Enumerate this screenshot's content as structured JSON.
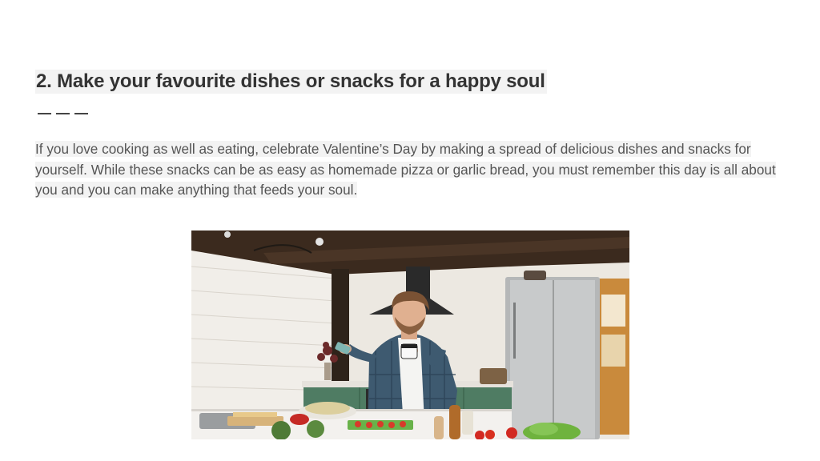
{
  "heading": "2. Make your favourite dishes or snacks for a happy soul",
  "paragraph": "If you love cooking as well as eating, celebrate Valentine’s Day by making a spread of delicious dishes and snacks for yourself. While these snacks can be as easy as homemade pizza or garlic bread, you must remember this day is all about you and you can make anything that feeds your soul.",
  "photo": {
    "subject": "man-with-coffee-cup-and-phone-in-kitchen",
    "colors": {
      "ceiling": "#3b2a1e",
      "wall": "#eeeae3",
      "shirt": "#3e5a70",
      "fridge": "#b5b7b8",
      "cabinets": "#4f7c63",
      "door": "#c98a3c"
    }
  }
}
